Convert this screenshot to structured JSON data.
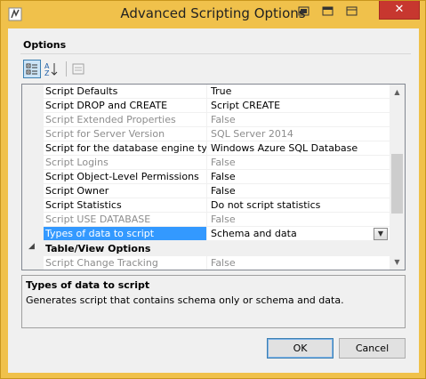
{
  "window": {
    "title": "Advanced Scripting Options",
    "close_glyph": "✕"
  },
  "toolbar": {
    "categorized_icon": "categorized-icon",
    "alphabetical_icon": "sort-az-icon",
    "property_pages_icon": "property-pages-icon"
  },
  "options_header": "Options",
  "grid": {
    "rows": [
      {
        "name": "Script Defaults",
        "value": "True",
        "disabled": false
      },
      {
        "name": "Script DROP and CREATE",
        "value": "Script CREATE",
        "disabled": false
      },
      {
        "name": "Script Extended Properties",
        "value": "False",
        "disabled": true
      },
      {
        "name": "Script for Server Version",
        "value": "SQL Server 2014",
        "disabled": true
      },
      {
        "name": "Script for the database engine type",
        "value": "Windows Azure SQL Database",
        "disabled": false
      },
      {
        "name": "Script Logins",
        "value": "False",
        "disabled": true
      },
      {
        "name": "Script Object-Level Permissions",
        "value": "False",
        "disabled": false
      },
      {
        "name": "Script Owner",
        "value": "False",
        "disabled": false
      },
      {
        "name": "Script Statistics",
        "value": "Do not script statistics",
        "disabled": false
      },
      {
        "name": "Script USE DATABASE",
        "value": "False",
        "disabled": true
      },
      {
        "name": "Types of data to script",
        "value": "Schema and data",
        "disabled": false,
        "selected": true
      }
    ],
    "category": {
      "glyph": "◢",
      "label": "Table/View Options"
    },
    "after_category": [
      {
        "name": "Script Change Tracking",
        "value": "False",
        "disabled": true
      }
    ]
  },
  "description": {
    "title": "Types of data to script",
    "text": "Generates script that contains schema only or schema and data."
  },
  "buttons": {
    "ok": "OK",
    "cancel": "Cancel"
  },
  "colors": {
    "frame": "#f0c14b",
    "selection": "#3399ff",
    "close": "#c7372f"
  }
}
